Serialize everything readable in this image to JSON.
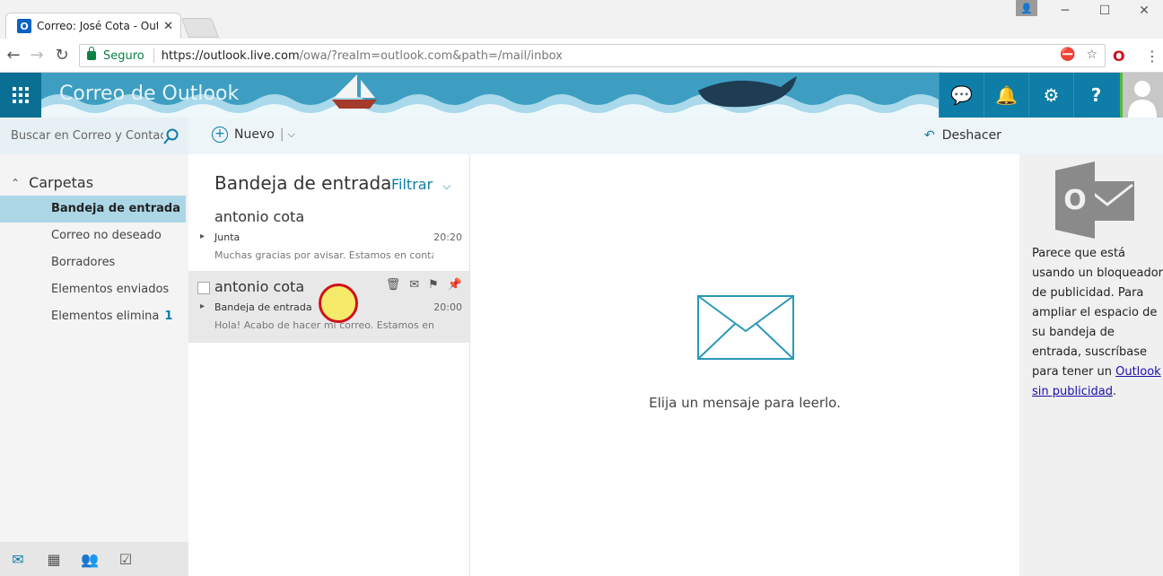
{
  "browser": {
    "tab_title": "Correo: José Cota - Outlo",
    "tab_favicon": "O",
    "tab_close": "✕",
    "secure_label": "Seguro",
    "url_host": "https://outlook.live.com",
    "url_path": "/owa/?realm=outlook.com&path=/mail/inbox"
  },
  "header": {
    "brand": "Correo de Outlook",
    "help": "?"
  },
  "toolbar": {
    "search_placeholder": "Buscar en Correo y Contac..",
    "new_label": "Nuevo",
    "undo_label": "Deshacer"
  },
  "folders": {
    "title": "Carpetas",
    "items": [
      {
        "label": "Bandeja de entrada",
        "count": ""
      },
      {
        "label": "Correo no deseado",
        "count": ""
      },
      {
        "label": "Borradores",
        "count": ""
      },
      {
        "label": "Elementos enviados",
        "count": ""
      },
      {
        "label": "Elementos elimina",
        "count": "1"
      }
    ]
  },
  "message_list": {
    "title": "Bandeja de entrada",
    "filter_label": "Filtrar",
    "messages": [
      {
        "sender": "antonio cota",
        "subject": "Junta",
        "time": "20:20",
        "preview": "Muchas gracias por avisar. Estamos en contac..."
      },
      {
        "sender": "antonio cota",
        "subject": "Bandeja de entrada",
        "time": "20:00",
        "preview": "Hola! Acabo de hacer mi correo. Estamos en ..."
      }
    ]
  },
  "reading_pane": {
    "empty_message": "Elija un mensaje para leerlo."
  },
  "ad_pane": {
    "logo_letter": "O",
    "text": "Parece que está usando un bloqueador de publicidad. Para ampliar el espacio de su bandeja de entrada, suscríbase para tener un ",
    "link": "Outlook sin publicidad",
    "text_end": "."
  },
  "colors": {
    "accent": "#0e7da7",
    "selected_folder": "#abd6e6"
  }
}
